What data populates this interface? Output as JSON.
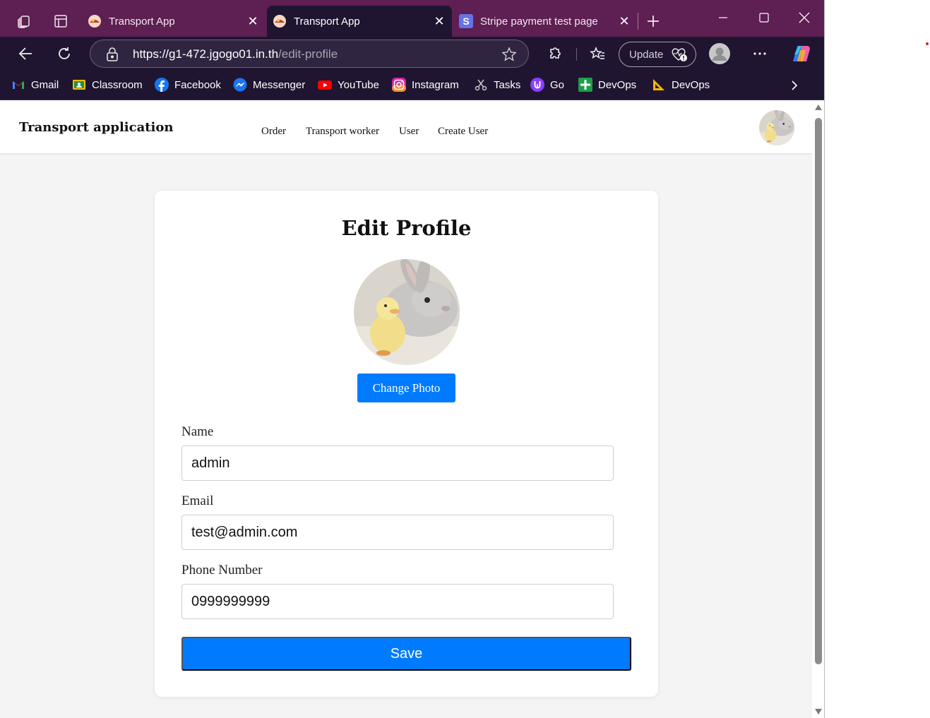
{
  "browser": {
    "tabs": [
      {
        "title": "Transport App",
        "active": false
      },
      {
        "title": "Transport App",
        "active": true
      },
      {
        "title": "Stripe payment test page",
        "active": false
      }
    ],
    "url_host": "https://g1-472.jgogo01.in.th",
    "url_path": "/edit-profile",
    "update_label": "Update",
    "bookmarks": [
      {
        "label": "Gmail",
        "icon": "gmail-icon"
      },
      {
        "label": "Classroom",
        "icon": "classroom-icon"
      },
      {
        "label": "Facebook",
        "icon": "facebook-icon"
      },
      {
        "label": "Messenger",
        "icon": "messenger-icon"
      },
      {
        "label": "YouTube",
        "icon": "youtube-icon"
      },
      {
        "label": "Instagram",
        "icon": "instagram-icon"
      },
      {
        "label": "Tasks",
        "icon": "tasks-icon"
      },
      {
        "label": "Go",
        "icon": "go-icon"
      },
      {
        "label": "DevOps",
        "icon": "devops-plus-icon"
      },
      {
        "label": "DevOps",
        "icon": "devops-ruler-icon"
      }
    ]
  },
  "app": {
    "brand": "Transport application",
    "nav": [
      "Order",
      "Transport worker",
      "User",
      "Create User"
    ]
  },
  "form": {
    "title": "Edit Profile",
    "change_photo_label": "Change Photo",
    "fields": [
      {
        "label": "Name",
        "value": "admin"
      },
      {
        "label": "Email",
        "value": "test@admin.com"
      },
      {
        "label": "Phone Number",
        "value": "0999999999"
      }
    ],
    "save_label": "Save"
  },
  "colors": {
    "tab_strip": "#5e1f52",
    "toolbar": "#1f1530",
    "primary_button": "#007bff"
  }
}
